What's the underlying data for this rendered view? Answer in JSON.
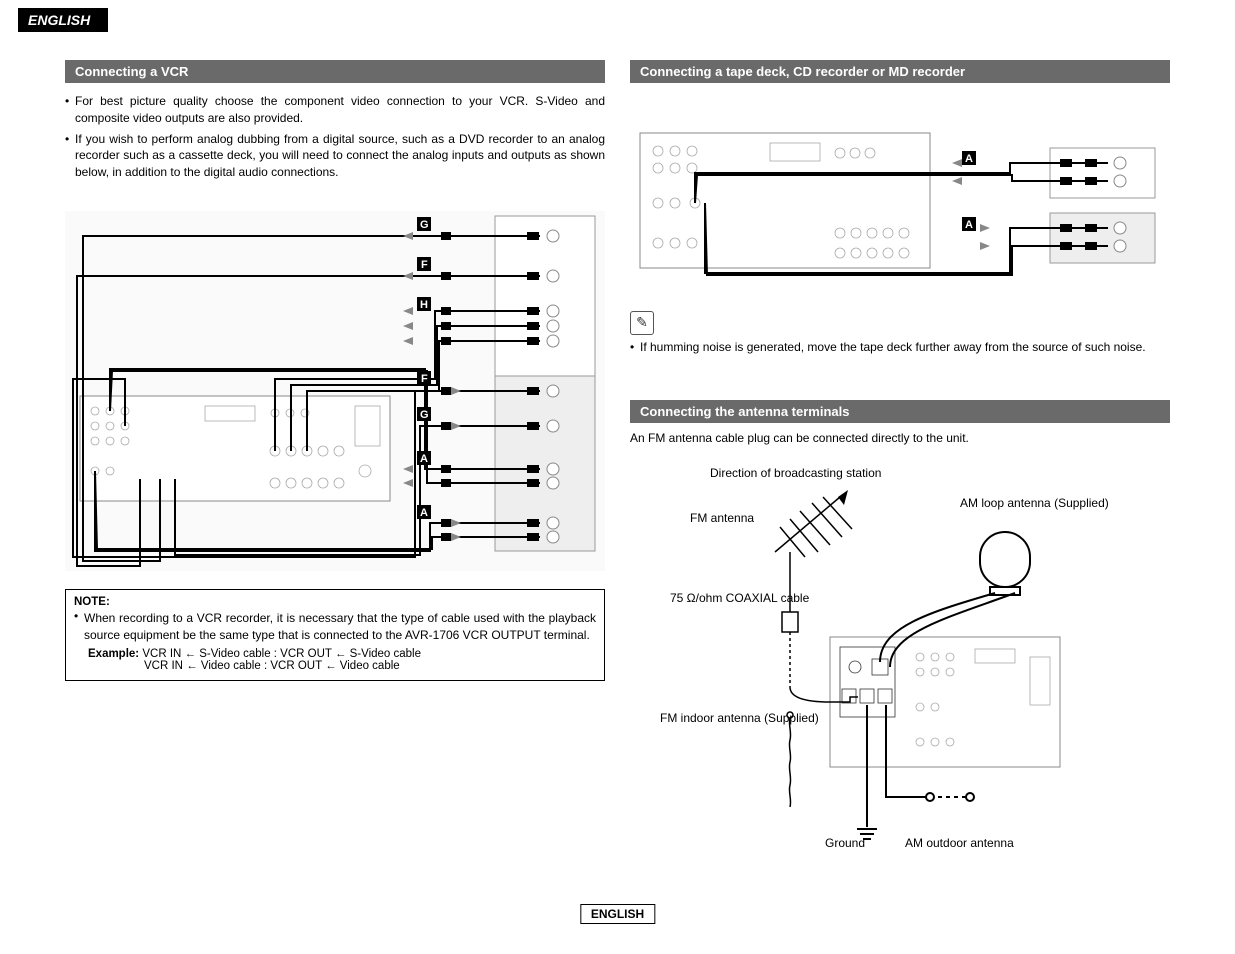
{
  "language_tab": "ENGLISH",
  "footer_language": "ENGLISH",
  "left": {
    "heading": "Connecting a VCR",
    "bullets": [
      "For best picture quality choose the component video connection to your VCR. S-Video and composite video outputs are also provided.",
      "If you wish to perform analog dubbing from a digital source, such as a DVD recorder to an analog recorder such as a cassette deck, you will need to connect the analog inputs and outputs as shown below, in addition to the digital audio connections."
    ],
    "diagram_labels": {
      "g": "G",
      "f": "F",
      "h": "H",
      "a": "A"
    },
    "note": {
      "title": "NOTE:",
      "text": "When recording to a VCR recorder, it is necessary that the type of cable used with the playback source equipment be the same type that is connected to the AVR-1706 VCR OUTPUT terminal.",
      "example_label": "Example:",
      "example_line1_a": "VCR IN ← S-Video cable : VCR OUT ← S-Video cable",
      "example_line2_a": "VCR IN ← Video cable : VCR OUT ← Video cable"
    }
  },
  "right": {
    "heading1": "Connecting a tape deck, CD recorder or MD recorder",
    "tape_labels": {
      "a": "A"
    },
    "tape_note": "If humming noise is generated, move the tape deck further away from the source of such noise.",
    "heading2": "Connecting the antenna terminals",
    "antenna_intro": "An FM antenna cable plug can be connected directly to the unit.",
    "antenna_labels": {
      "direction": "Direction of broadcasting station",
      "fm_antenna": "FM antenna",
      "am_loop": "AM loop antenna (Supplied)",
      "coax": "75 Ω/ohm COAXIAL cable",
      "fm_indoor": "FM indoor antenna (Supplied)",
      "ground": "Ground",
      "am_outdoor": "AM outdoor antenna"
    }
  }
}
